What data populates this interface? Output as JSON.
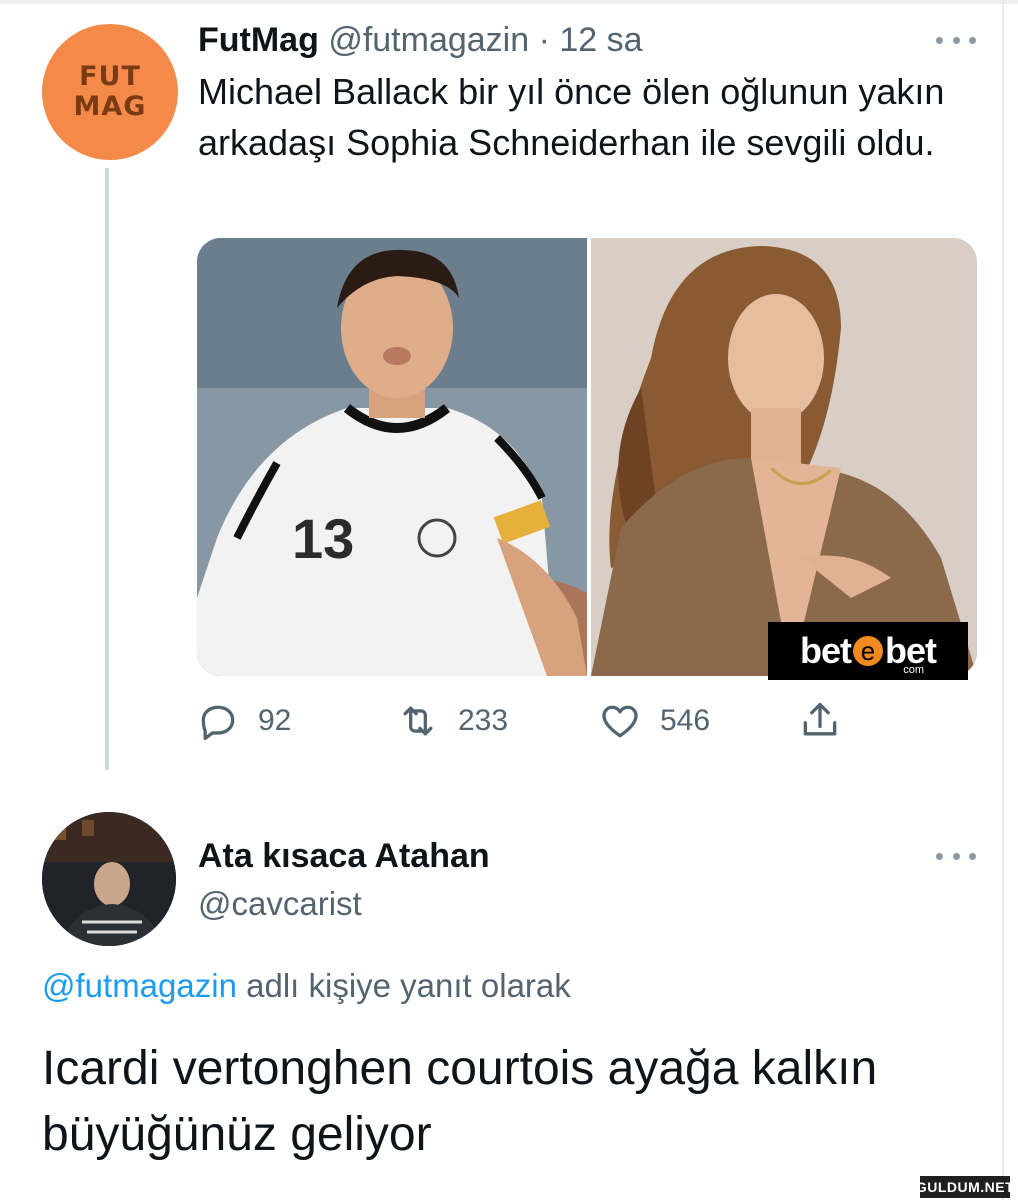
{
  "tweet": {
    "avatar_text_line1": "FUT",
    "avatar_text_line2": "MAG",
    "name": "FutMag",
    "handle": "@futmagazin",
    "separator": "·",
    "time": "12 sa",
    "text": "Michael Ballack bir yıl önce ölen oğlunun yakın arkadaşı Sophia Schneiderhan ile sevgili oldu.",
    "media_badge": {
      "part1": "bet",
      "part2": "bet",
      "suffix": "com"
    },
    "actions": {
      "replies": "92",
      "retweets": "233",
      "likes": "546"
    }
  },
  "reply": {
    "name": "Ata kısaca Atahan",
    "handle": "@cavcarist",
    "replying_mention": "@futmagazin",
    "replying_suffix": "adlı kişiye yanıt olarak",
    "text": "Icardi vertonghen courtois ayağa kalkın büyüğünüz geliyor"
  },
  "watermark": "GULDUM.NET",
  "colors": {
    "avatar_bg": "#f48a4a",
    "link": "#1d9bf0",
    "muted": "#536471"
  }
}
